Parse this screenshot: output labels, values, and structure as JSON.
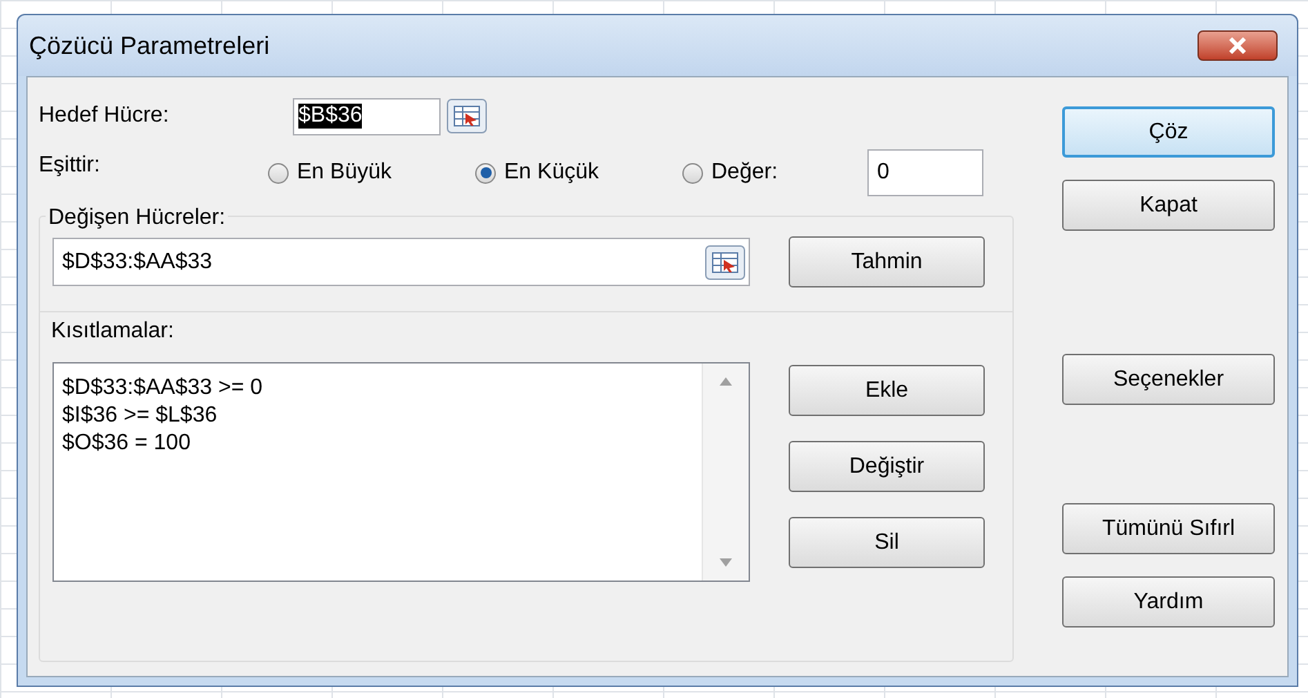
{
  "window": {
    "title": "Çözücü Parametreleri"
  },
  "target_cell": {
    "label": "Hedef Hücre:",
    "value": "$B$36"
  },
  "equals": {
    "label": "Eşittir:",
    "options": [
      {
        "label": "En Büyük",
        "selected": false
      },
      {
        "label": "En Küçük",
        "selected": true
      },
      {
        "label": "Değer:",
        "selected": false
      }
    ],
    "value": "0"
  },
  "changing_cells": {
    "label": "Değişen Hücreler:",
    "value": "$D$33:$AA$33",
    "button": "Tahmin"
  },
  "constraints": {
    "label": "Kısıtlamalar:",
    "items": [
      "$D$33:$AA$33 >= 0",
      "$I$36 >= $L$36",
      "$O$36 = 100"
    ],
    "buttons": [
      "Ekle",
      "Değiştir",
      "Sil"
    ]
  },
  "side_buttons": [
    {
      "label": "Çöz",
      "focused": true
    },
    {
      "label": "Kapat",
      "focused": false
    },
    {
      "label": "Seçenekler",
      "focused": false
    },
    {
      "label": "Tümünü Sıfırl",
      "focused": false
    },
    {
      "label": "Yardım",
      "focused": false
    }
  ]
}
